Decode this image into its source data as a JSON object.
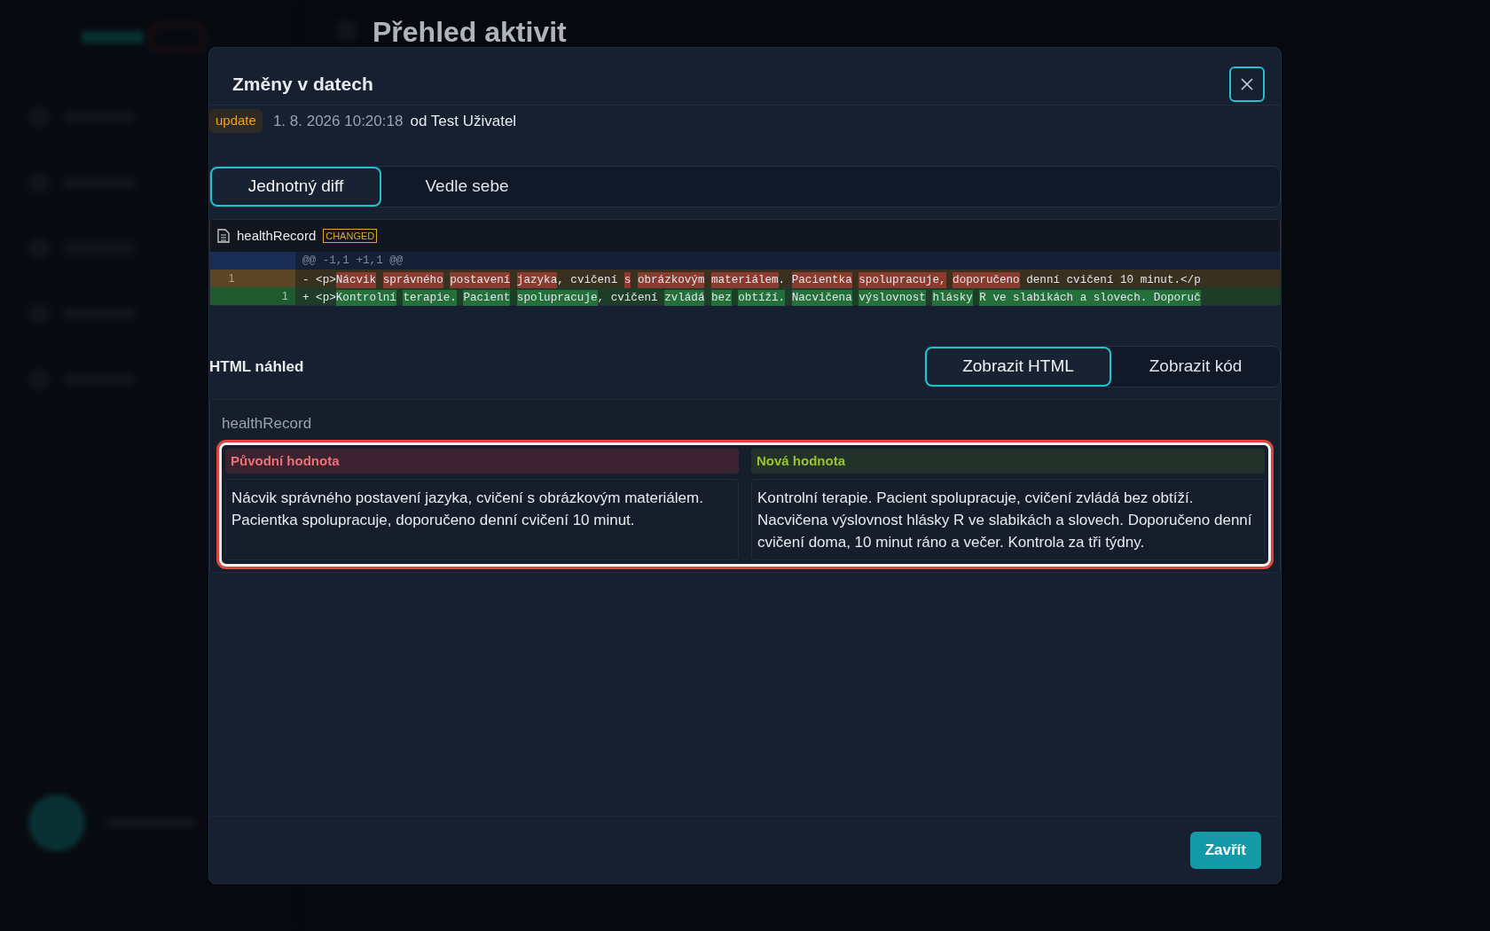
{
  "background": {
    "page_title": "Přehled aktivit"
  },
  "dialog": {
    "title": "Změny v datech",
    "action": "update",
    "timestamp": "1. 8. 2026 10:20:18",
    "author": "od Test Uživatel",
    "tabs": [
      {
        "label": "Jednotný diff",
        "selected": true
      },
      {
        "label": "Vedle sebe",
        "selected": false
      }
    ],
    "diff": {
      "field": "healthRecord",
      "badge": "CHANGED",
      "hunk": "@@ -1,1 +1,1 @@",
      "lines": [
        {
          "kind": "removed",
          "old_number": "1",
          "segments": [
            {
              "text": "- <p>",
              "changed": false
            },
            {
              "text": "Nácvik",
              "changed": true,
              "space_after": true
            },
            {
              "text": "správného",
              "changed": true,
              "space_after": true
            },
            {
              "text": "postavení",
              "changed": true,
              "space_after": true
            },
            {
              "text": "jazyka",
              "changed": true
            },
            {
              "text": ", cvičení",
              "changed": false,
              "space_after": true
            },
            {
              "text": "s",
              "changed": true,
              "space_after": true
            },
            {
              "text": "obrázkovým",
              "changed": true,
              "space_after": true
            },
            {
              "text": "materiálem",
              "changed": true
            },
            {
              "text": ".",
              "changed": false,
              "space_after": true
            },
            {
              "text": "Pacientka",
              "changed": true,
              "space_after": true
            },
            {
              "text": "spolupracuje,",
              "changed": true,
              "space_after": true
            },
            {
              "text": "doporučeno",
              "changed": true,
              "space_after": true
            },
            {
              "text": "denní cvičení 10 minut.</p",
              "changed": false
            }
          ]
        },
        {
          "kind": "added",
          "new_number": "1",
          "segments": [
            {
              "text": "+ <p>",
              "changed": false
            },
            {
              "text": "Kontrolní",
              "changed": true,
              "space_after": true
            },
            {
              "text": "terapie.",
              "changed": true,
              "space_after": true
            },
            {
              "text": "Pacient",
              "changed": true,
              "space_after": true
            },
            {
              "text": "spolupracuje",
              "changed": true
            },
            {
              "text": ", cvičení",
              "changed": false,
              "space_after": true
            },
            {
              "text": "zvládá",
              "changed": true,
              "space_after": true
            },
            {
              "text": "bez",
              "changed": true,
              "space_after": true
            },
            {
              "text": "obtíží.",
              "changed": true,
              "space_after": true
            },
            {
              "text": "Nacvičena",
              "changed": true,
              "space_after": true
            },
            {
              "text": "výslovnost",
              "changed": true,
              "space_after": true
            },
            {
              "text": "hlásky",
              "changed": true,
              "space_after": true
            },
            {
              "text": "R ve slabikách a slovech. Doporuč",
              "changed": true
            }
          ]
        }
      ]
    },
    "preview": {
      "heading": "HTML náhled",
      "views": [
        {
          "label": "Zobrazit HTML",
          "selected": true
        },
        {
          "label": "Zobrazit kód",
          "selected": false
        }
      ],
      "field": "healthRecord",
      "old": {
        "label": "Původní hodnota",
        "text": "Nácvik správného postavení jazyka, cvičení s obrázkovým materiálem. Pacientka spolupracuje, doporučeno denní cvičení 10 minut."
      },
      "new": {
        "label": "Nová hodnota",
        "text": "Kontrolní terapie. Pacient spolupracuje, cvičení zvládá bez obtíží. Nacvičena výslovnost hlásky R ve slabikách a slovech. Doporučeno denní cvičení doma, 10 minut ráno a večer. Kontrola za tři týdny."
      }
    },
    "close_button": "Zavřít"
  }
}
